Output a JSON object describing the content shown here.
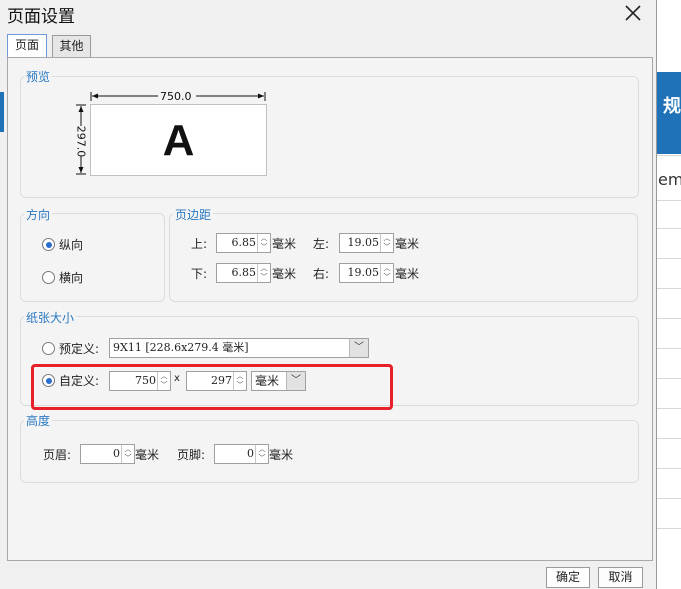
{
  "dialog": {
    "title": "页面设置"
  },
  "tabs": [
    {
      "label": "页面"
    },
    {
      "label": "其他"
    }
  ],
  "preview": {
    "title": "预览",
    "width_label": "750.0",
    "height_label": "297.0",
    "letter": "A"
  },
  "orientation": {
    "title": "方向",
    "portrait": "纵向",
    "landscape": "横向",
    "selected": "portrait"
  },
  "margins": {
    "title": "页边距",
    "top_label": "上:",
    "top_value": "6.85",
    "left_label": "左:",
    "left_value": "19.05",
    "bottom_label": "下:",
    "bottom_value": "6.85",
    "right_label": "右:",
    "right_value": "19.05",
    "unit": "毫米"
  },
  "paper": {
    "title": "纸张大小",
    "preset_label": "预定义:",
    "preset_value": "9X11 [228.6x279.4 毫米]",
    "custom_label": "自定义:",
    "width": "750",
    "sep": "x",
    "height": "297",
    "unit": "毫米",
    "selected": "custom"
  },
  "height_section": {
    "title": "高度",
    "header_label": "页眉:",
    "header_value": "0",
    "footer_label": "页脚:",
    "footer_value": "0",
    "unit": "毫米"
  },
  "buttons": {
    "ok": "确定",
    "cancel": "取消"
  },
  "background": {
    "blue_text": "规",
    "em_text": "em_"
  },
  "colors": {
    "accent": "#2a78c2",
    "highlight": "#e8202a"
  },
  "icons": {
    "close": "close-icon",
    "spin_up": "chevron-up-icon",
    "spin_down": "chevron-down-icon",
    "dropdown": "chevron-down-icon"
  }
}
